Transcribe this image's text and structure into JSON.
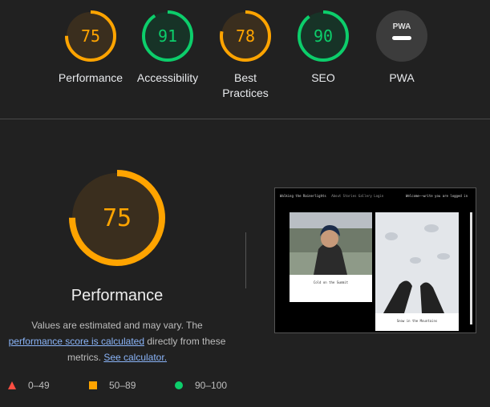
{
  "gauges": [
    {
      "score": "75",
      "label": "Performance",
      "color": "#ffa400",
      "fill": "#3a2e1e",
      "fraction": 0.75
    },
    {
      "score": "91",
      "label": "Accessibility",
      "color": "#0cce6b",
      "fill": "#173327",
      "fraction": 0.91
    },
    {
      "score": "78",
      "label_line1": "Best",
      "label_line2": "Practices",
      "color": "#ffa400",
      "fill": "#3a2e1e",
      "fraction": 0.78
    },
    {
      "score": "90",
      "label": "SEO",
      "color": "#0cce6b",
      "fill": "#173327",
      "fraction": 0.9
    },
    {
      "badge": "PWA",
      "label": "PWA",
      "fill": "#3c3c3c"
    }
  ],
  "main": {
    "score": "75",
    "fraction": 0.75,
    "title": "Performance",
    "desc_pre": "Values are estimated and may vary. The",
    "desc_link1": "performance score is calculated",
    "desc_mid": "directly from these metrics.",
    "desc_link2": "See calculator."
  },
  "legend": [
    {
      "range": "0–49",
      "color": "#ff4e42",
      "shape": "triangle"
    },
    {
      "range": "50–89",
      "color": "#ffa400",
      "shape": "square"
    },
    {
      "range": "90–100",
      "color": "#0cce6b",
      "shape": "circle"
    }
  ],
  "screenshot": {
    "site_title": "Walking the Rainerlights",
    "nav": "About Stories Gallery Login",
    "top_right": "Welcome——write you are logged in",
    "card1_title": "Cold on the Summit",
    "card2_title": "Snow in the Mountains"
  },
  "colors": {
    "background": "#212121",
    "link": "#8ab4f8"
  }
}
